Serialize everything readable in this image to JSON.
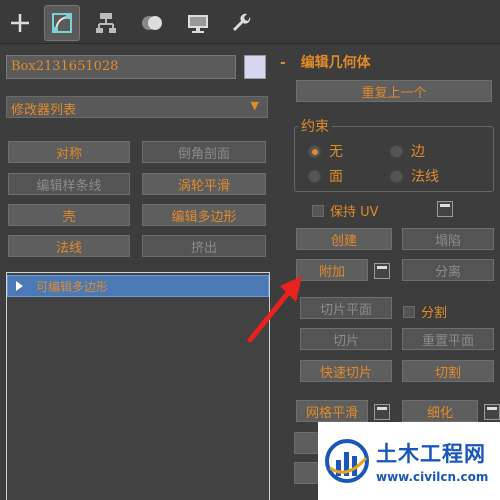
{
  "object_name": "Box2131651028",
  "modifier_list": {
    "label": "修改器列表",
    "arrow": "▼"
  },
  "modifier_buttons": [
    {
      "label": "对称",
      "enabled": true
    },
    {
      "label": "倒角剖面",
      "enabled": false
    },
    {
      "label": "编辑样条线",
      "enabled": false
    },
    {
      "label": "涡轮平滑",
      "enabled": true
    },
    {
      "label": "壳",
      "enabled": true
    },
    {
      "label": "编辑多边形",
      "enabled": true
    },
    {
      "label": "法线",
      "enabled": true
    },
    {
      "label": "挤出",
      "enabled": false
    }
  ],
  "stack": {
    "item_label": "可编辑多边形"
  },
  "rollout": {
    "title": "编辑几何体",
    "collapse": "-",
    "repeat_last": "重复上一个",
    "constraints": {
      "title": "约束",
      "options": [
        "无",
        "边",
        "面",
        "法线"
      ],
      "selected": "无"
    },
    "preserve_uv": "保持 UV",
    "buttons": {
      "create": "创建",
      "collapse": "塌陷",
      "attach": "附加",
      "detach": "分离",
      "slice_plane": "切片平面",
      "split": "分割",
      "slice": "切片",
      "reset_plane": "重置平面",
      "quickslice": "快速切片",
      "cut": "切割",
      "meshsmooth": "网格平滑",
      "tessellate": "细化"
    }
  },
  "watermark": {
    "title": "土木工程网",
    "url": "www.civilcn.com"
  },
  "colors": {
    "accent": "#e08a2a",
    "panel": "#3d3d3d",
    "button": "#5e5e5e",
    "selection": "#4a79b5",
    "arrow": "#e8231f",
    "swatch": "#d6d6f0"
  },
  "icons": [
    "create-plus-icon",
    "modify-icon",
    "hierarchy-icon",
    "motion-icon",
    "display-icon",
    "utilities-wrench-icon"
  ]
}
